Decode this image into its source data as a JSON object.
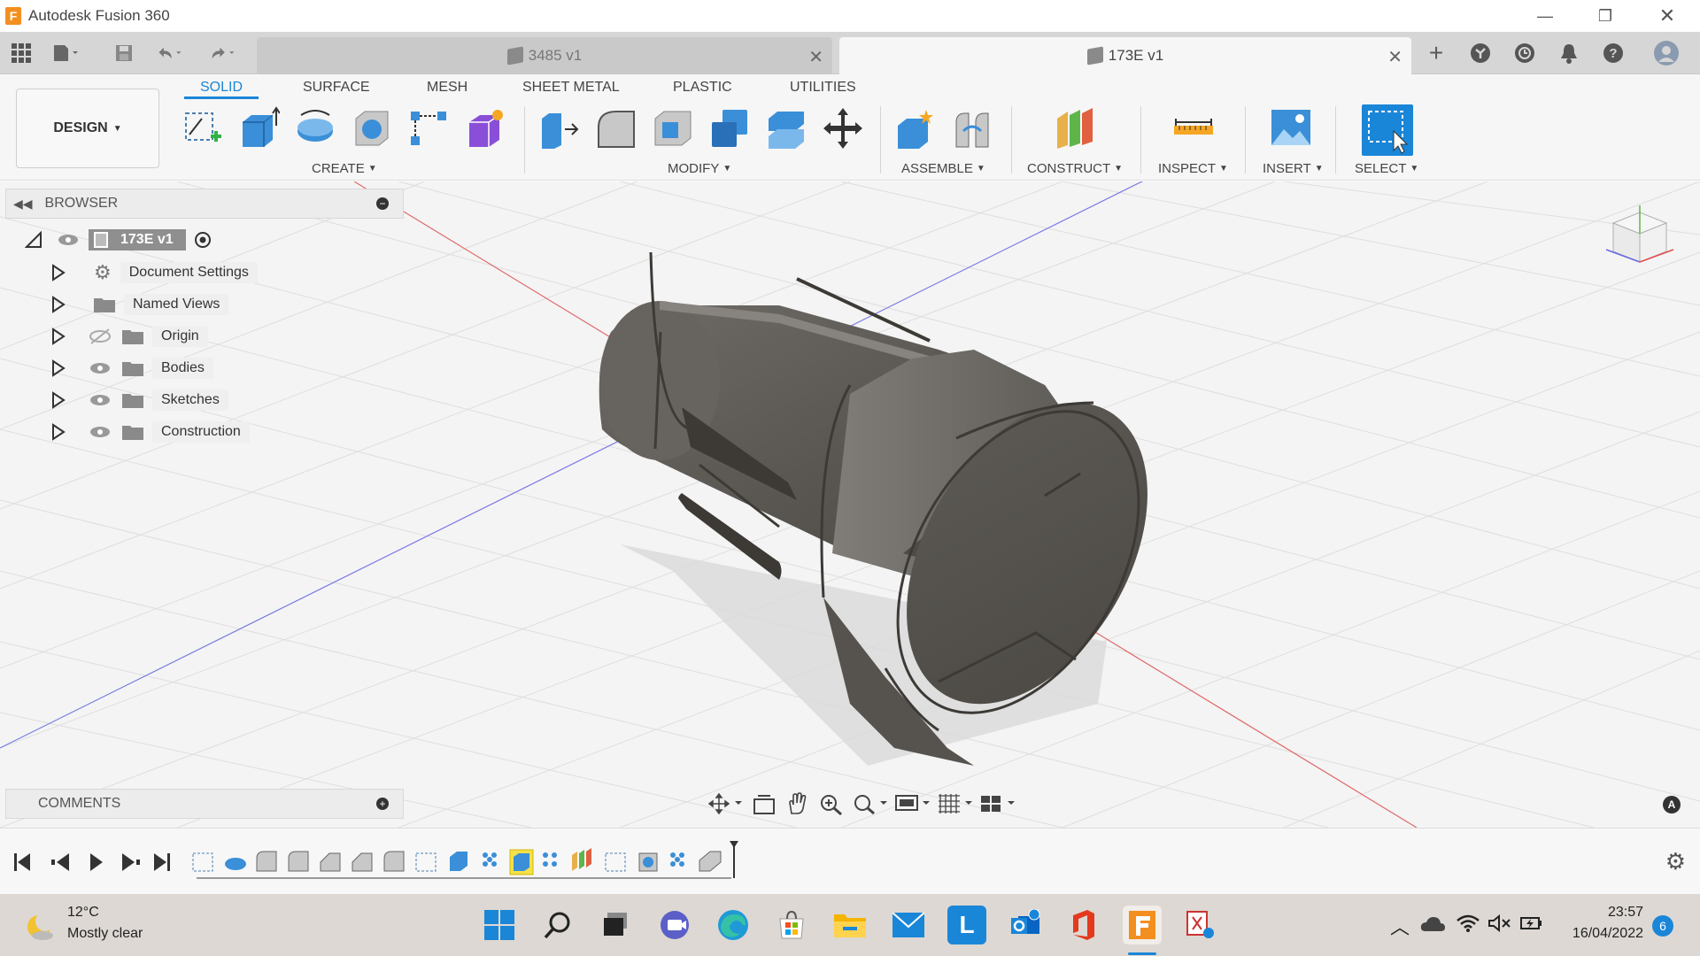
{
  "app": {
    "title": "Autodesk Fusion 360",
    "logo_letter": "F"
  },
  "tabs": [
    {
      "label": "3485 v1",
      "active": false
    },
    {
      "label": "173E v1",
      "active": true
    }
  ],
  "toolbar": {
    "workspace": "DESIGN",
    "workspace_tabs": [
      "SOLID",
      "SURFACE",
      "MESH",
      "SHEET METAL",
      "PLASTIC",
      "UTILITIES"
    ],
    "groups": [
      "CREATE",
      "MODIFY",
      "ASSEMBLE",
      "CONSTRUCT",
      "INSPECT",
      "INSERT",
      "SELECT"
    ]
  },
  "browser": {
    "title": "BROWSER",
    "root": "173E v1",
    "items": [
      "Document Settings",
      "Named Views",
      "Origin",
      "Bodies",
      "Sketches",
      "Construction"
    ]
  },
  "comments": {
    "title": "COMMENTS"
  },
  "taskbar": {
    "weather_temp": "12°C",
    "weather_desc": "Mostly clear",
    "time": "23:57",
    "date": "16/04/2022",
    "notification_count": "6"
  },
  "colors": {
    "accent": "#1a86d8",
    "fusion_orange": "#f28f1e",
    "axis_red": "#e05050",
    "axis_blue": "#6a6ae0"
  },
  "icons": [
    "app-grid-icon",
    "file-icon",
    "save-icon",
    "undo-icon",
    "redo-icon",
    "new-tab-icon",
    "extensions-icon",
    "job-status-icon",
    "notifications-icon",
    "help-icon",
    "profile-icon"
  ]
}
